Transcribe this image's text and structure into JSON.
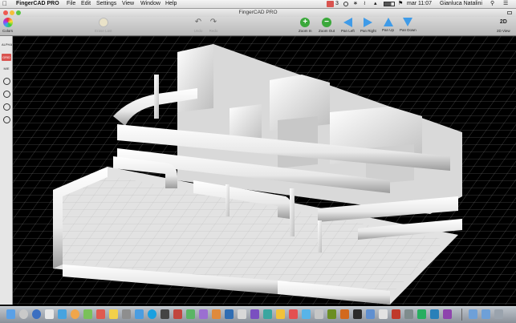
{
  "menubar": {
    "app_name": "FingerCAD PRO",
    "menus": [
      "File",
      "Edit",
      "Settings",
      "View",
      "Window",
      "Help"
    ],
    "status": {
      "badge": "3",
      "clock": "mar 11:07",
      "user": "Gianluca Natalini"
    }
  },
  "window": {
    "title": "FingerCAD PRO"
  },
  "toolbar": {
    "colors_label": "Colors",
    "erase_label": "Erase Last",
    "undo_label": "Undo",
    "redo_label": "Redo",
    "zoom_in_label": "Zoom In",
    "zoom_out_label": "Zoom Out",
    "pan_left_label": "Pan Left",
    "pan_right_label": "Pan Right",
    "pan_up_label": "Pan Up",
    "pan_down_label": "Pan Down",
    "view_2d_label": "2D View",
    "view_2d_badge": "2D"
  },
  "sidebar": {
    "alpha_label": "ALPHA",
    "grid_label": "GRID",
    "mode_label": "M/E"
  },
  "colors": {
    "zoom": "#3aa83a",
    "pan": "#3f9be8",
    "accent_red": "#d9534f"
  }
}
